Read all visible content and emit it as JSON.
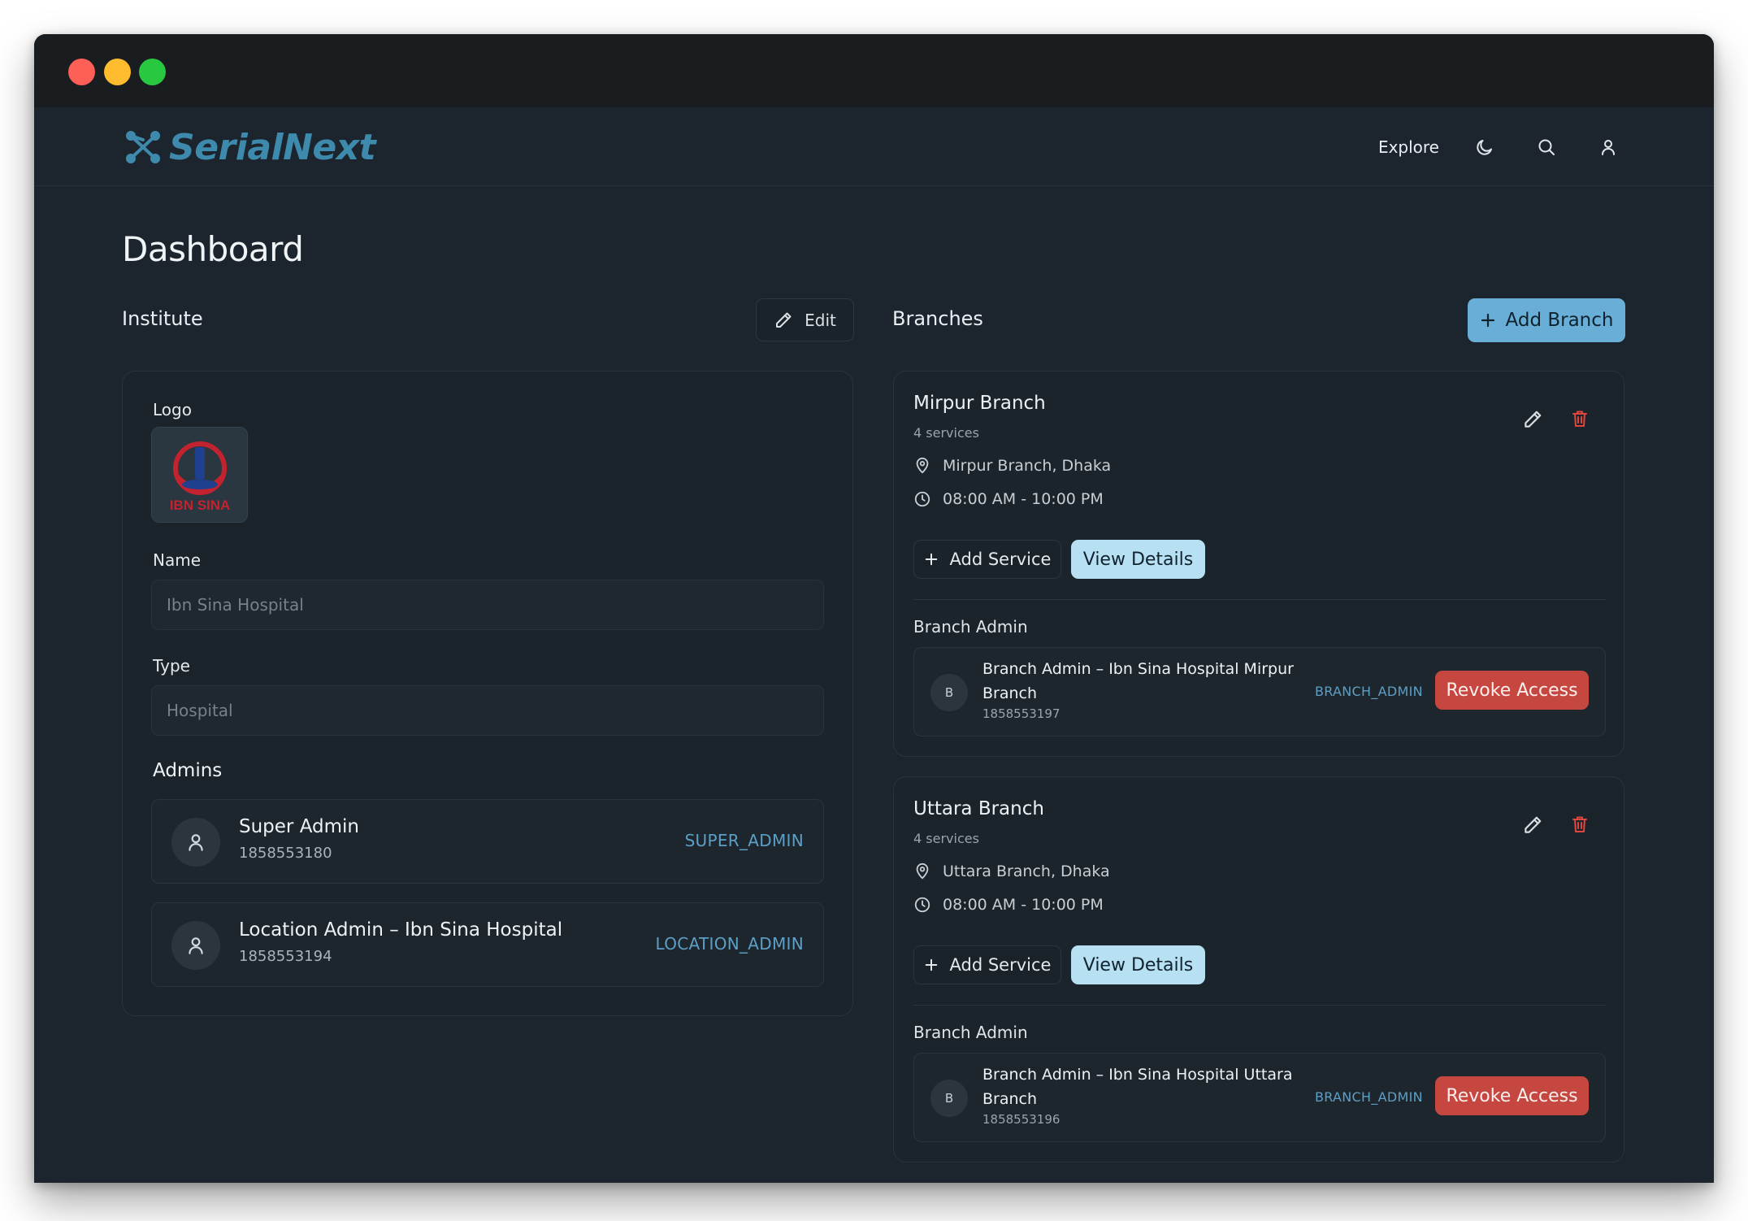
{
  "window": {
    "controls": [
      "close",
      "minimize",
      "maximize"
    ]
  },
  "brand": {
    "name": "SerialNext",
    "color": "#3e8aad",
    "icon": "network-logo-icon"
  },
  "nav": {
    "explore_label": "Explore",
    "icons": [
      "moon-icon",
      "search-icon",
      "user-icon"
    ]
  },
  "page": {
    "title": "Dashboard"
  },
  "institute": {
    "section_title": "Institute",
    "edit_label": "Edit",
    "logo_label": "Logo",
    "logo_text": "IBN SINA",
    "name_label": "Name",
    "name_placeholder": "Ibn Sina Hospital",
    "type_label": "Type",
    "type_placeholder": "Hospital",
    "admins_title": "Admins",
    "admins": [
      {
        "name": "Super Admin",
        "phone": "1858553180",
        "role": "SUPER_ADMIN"
      },
      {
        "name": "Location Admin – Ibn Sina Hospital",
        "phone": "1858553194",
        "role": "LOCATION_ADMIN"
      }
    ]
  },
  "branches": {
    "section_title": "Branches",
    "add_branch_label": "Add Branch",
    "items": [
      {
        "name": "Mirpur Branch",
        "services": "4 services",
        "location": "Mirpur Branch, Dhaka",
        "hours": "08:00 AM - 10:00 PM",
        "add_service_label": "Add Service",
        "view_details_label": "View Details",
        "branch_admin_title": "Branch Admin",
        "admin": {
          "initial": "B",
          "name": "Branch Admin – Ibn Sina Hospital Mirpur Branch",
          "phone": "1858553197",
          "role": "BRANCH_ADMIN",
          "revoke_label": "Revoke Access"
        }
      },
      {
        "name": "Uttara Branch",
        "services": "4 services",
        "location": "Uttara Branch, Dhaka",
        "hours": "08:00 AM - 10:00 PM",
        "add_service_label": "Add Service",
        "view_details_label": "View Details",
        "branch_admin_title": "Branch Admin",
        "admin": {
          "initial": "B",
          "name": "Branch Admin – Ibn Sina Hospital Uttara Branch",
          "phone": "1858553196",
          "role": "BRANCH_ADMIN",
          "revoke_label": "Revoke Access"
        }
      }
    ]
  },
  "colors": {
    "background": "#1c252d",
    "accent": "#69aed6",
    "view_details": "#b7e0f2",
    "revoke": "#c5473f",
    "role_text": "#5c9fc7",
    "delete_icon": "#e0463c"
  }
}
